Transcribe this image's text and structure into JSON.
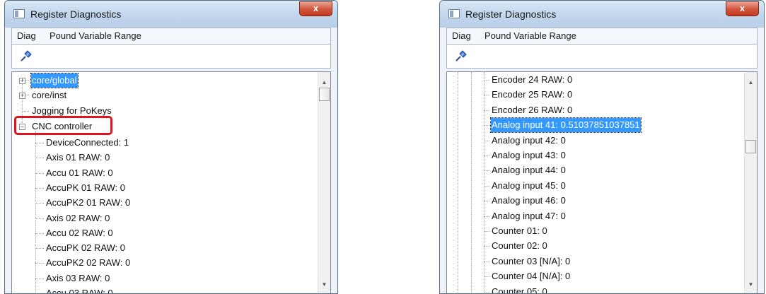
{
  "left_window": {
    "title": "Register Diagnostics",
    "close_symbol": "x",
    "menu": [
      "Diag",
      "Pound Variable Range"
    ],
    "tree": {
      "roots": [
        {
          "label": "core/global",
          "expander": "+",
          "selected": true
        },
        {
          "label": "core/inst",
          "expander": "+"
        },
        {
          "label": "Jogging for PoKeys"
        },
        {
          "label": "CNC controller",
          "expander": "−",
          "highlighted": true
        }
      ],
      "children": [
        "DeviceConnected: 1",
        "Axis 01 RAW: 0",
        "Accu 01 RAW: 0",
        "AccuPK 01 RAW: 0",
        "AccuPK2 01 RAW: 0",
        "Axis 02 RAW: 0",
        "Accu 02 RAW: 0",
        "AccuPK 02 RAW: 0",
        "AccuPK2 02 RAW: 0",
        "Axis 03 RAW: 0",
        "Accu 03 RAW: 0"
      ]
    }
  },
  "right_window": {
    "title": "Register Diagnostics",
    "close_symbol": "x",
    "menu": [
      "Diag",
      "Pound Variable Range"
    ],
    "tree": {
      "items": [
        "Encoder 24 RAW: 0",
        "Encoder 25 RAW: 0",
        "Encoder 26 RAW: 0",
        "Analog input 41: 0.51037851037851",
        "Analog input 42: 0",
        "Analog input 43: 0",
        "Analog input 44: 0",
        "Analog input 45: 0",
        "Analog input 46: 0",
        "Analog input 47: 0",
        "Counter 01: 0",
        "Counter 02: 0",
        "Counter 03 [N/A]: 0",
        "Counter 04 [N/A]: 0",
        "Counter 05: 0"
      ],
      "selected_index": 3
    }
  },
  "colors": {
    "selection": "#3399ff",
    "highlight": "#e0141e"
  },
  "icons": {
    "app": "window-icon",
    "close": "close-icon",
    "toolbar": "pin-icon",
    "scroll_up": "scroll-up-arrow-icon",
    "scroll_down": "scroll-down-arrow-icon"
  }
}
